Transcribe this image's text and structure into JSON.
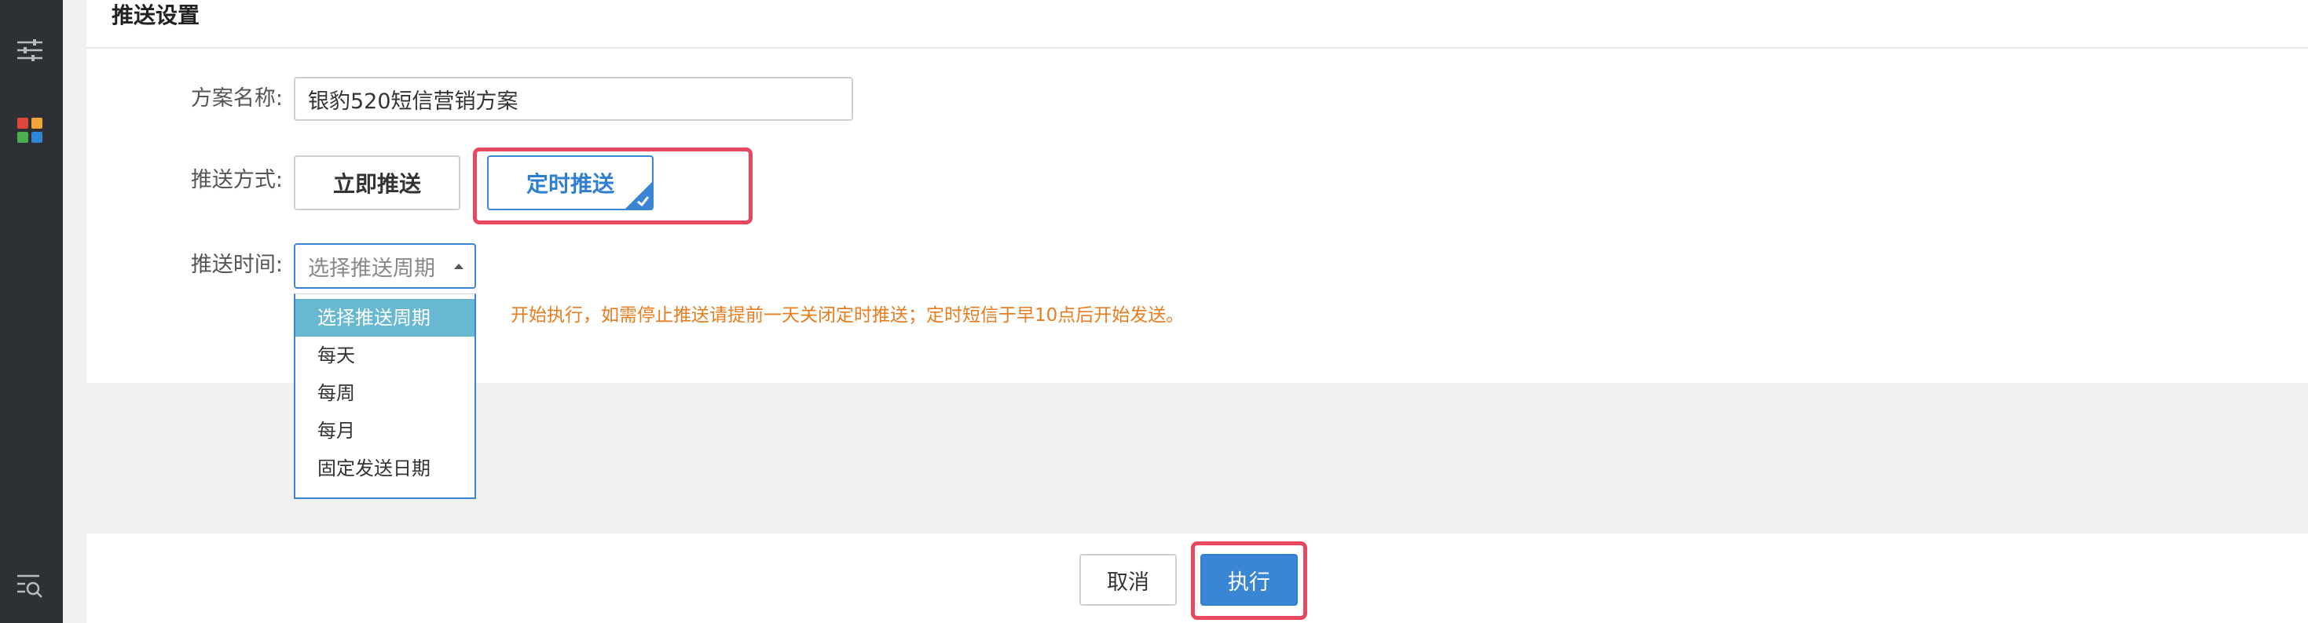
{
  "sidebar": {
    "icons": [
      "sliders-icon",
      "apps-grid-icon",
      "list-search-icon"
    ]
  },
  "panel": {
    "title": "推送设置"
  },
  "form": {
    "plan_name_label": "方案名称:",
    "plan_name_value": "银豹520短信营销方案",
    "push_mode_label": "推送方式:",
    "push_modes": [
      {
        "label": "立即推送",
        "selected": false
      },
      {
        "label": "定时推送",
        "selected": true
      }
    ],
    "push_time_label": "推送时间:",
    "push_time_select": {
      "placeholder": "选择推送周期",
      "options": [
        "选择推送周期",
        "每天",
        "每周",
        "每月",
        "固定发送日期"
      ],
      "highlighted_option": "选择推送周期"
    },
    "hint_text": "开始执行，如需停止推送请提前一天关闭定时推送；定时短信于早10点后开始发送。"
  },
  "footer": {
    "cancel_label": "取消",
    "execute_label": "执行"
  },
  "colors": {
    "accent": "#3a86d4",
    "highlight_red": "#e8485f",
    "hint_orange": "#e87c1e",
    "option_active": "#67b8d0",
    "rail": "#2d3136"
  }
}
